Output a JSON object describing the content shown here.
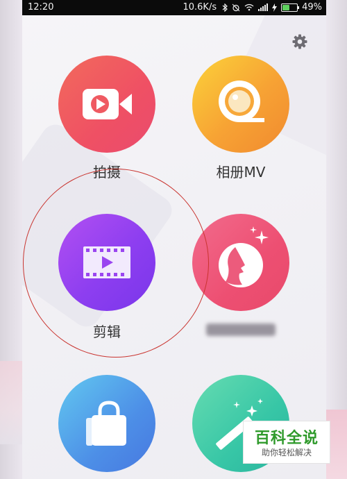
{
  "status_bar": {
    "time": "12:20",
    "network_speed": "10.6K/s",
    "battery_percent": "49%",
    "battery_level": 0.49,
    "icons": [
      "bluetooth-icon",
      "alarm-icon",
      "wifi-icon",
      "signal-icon",
      "charging-icon",
      "battery-icon"
    ]
  },
  "toolbar": {
    "settings_icon": "gear-icon"
  },
  "menu": {
    "items": [
      {
        "label": "拍摄",
        "icon": "video-camera-icon",
        "colors": [
          "#f26a5c",
          "#ea4b6e"
        ]
      },
      {
        "label": "相册MV",
        "icon": "film-reel-icon",
        "colors": [
          "#fbd23a",
          "#f08a2f"
        ]
      },
      {
        "label": "剪辑",
        "icon": "film-strip-play-icon",
        "colors": [
          "#b250f2",
          "#7a36ea"
        ]
      },
      {
        "label": "",
        "icon": "face-sparkle-icon",
        "colors": [
          "#f26b8c",
          "#e84a6b"
        ]
      },
      {
        "label": "",
        "icon": "shopping-bag-icon",
        "colors": [
          "#62c8f0",
          "#4778e0"
        ]
      },
      {
        "label": "",
        "icon": "magic-wand-icon",
        "colors": [
          "#66dcb1",
          "#2ab49e"
        ]
      }
    ]
  },
  "watermark": {
    "title": "百科全说",
    "subtitle": "助你轻松解决"
  },
  "annotation_color": "#c9342f"
}
